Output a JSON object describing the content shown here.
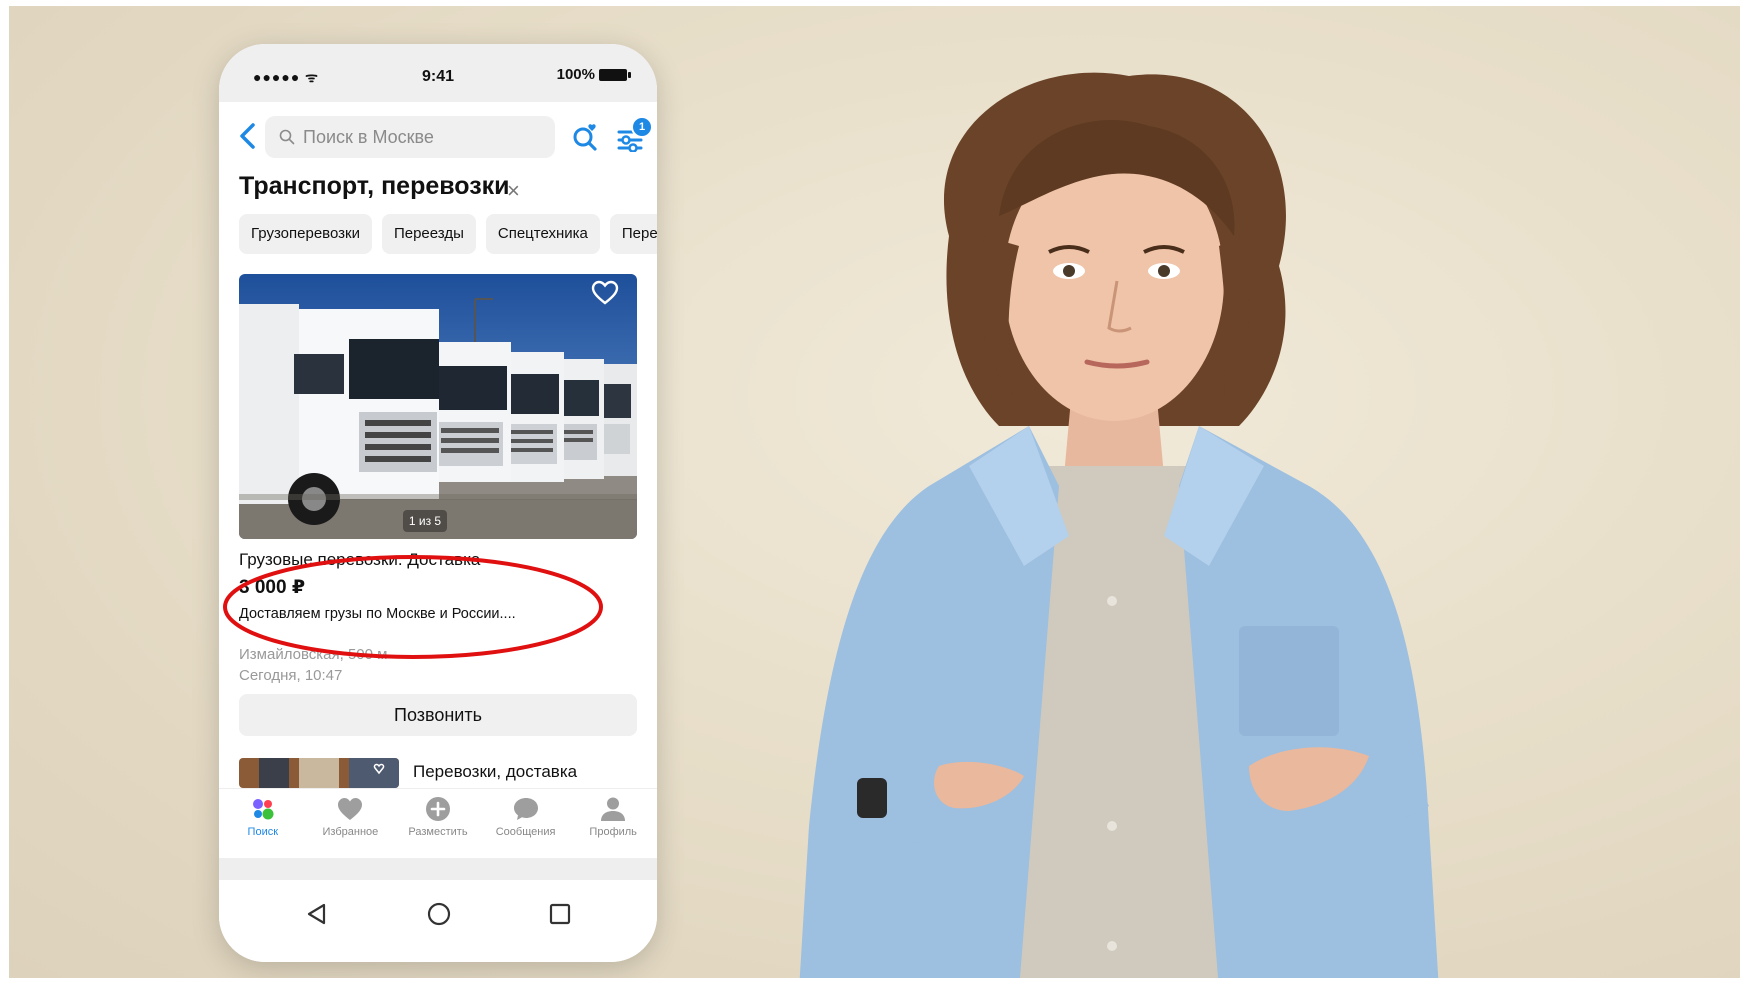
{
  "status_bar": {
    "signal": "●●●●● ᯤ",
    "time": "9:41",
    "battery": "100%"
  },
  "search": {
    "placeholder": "Поиск в Москве",
    "filter_badge": "1"
  },
  "category": {
    "title": "Транспорт, перевозки",
    "close": "×"
  },
  "chips": [
    "Грузоперевозки",
    "Переезды",
    "Спецтехника",
    "Пере"
  ],
  "listing": {
    "pager": "1 из 5",
    "title": "Грузовые перевозки. Доставка",
    "price": "3 000 ₽",
    "description": "Доставляем грузы по Москве и России....",
    "location": "Измайловская, 500 м",
    "date": "Сегодня, 10:47",
    "call_label": "Позвонить"
  },
  "listing2": {
    "title": "Перевозки, доставка"
  },
  "tabbar": {
    "search": "Поиск",
    "favorites": "Избранное",
    "post": "Разместить",
    "messages": "Сообщения",
    "profile": "Профиль"
  },
  "colors": {
    "accent": "#1e88e5",
    "highlight_ellipse": "#e01010",
    "background": "#e8dfca"
  }
}
